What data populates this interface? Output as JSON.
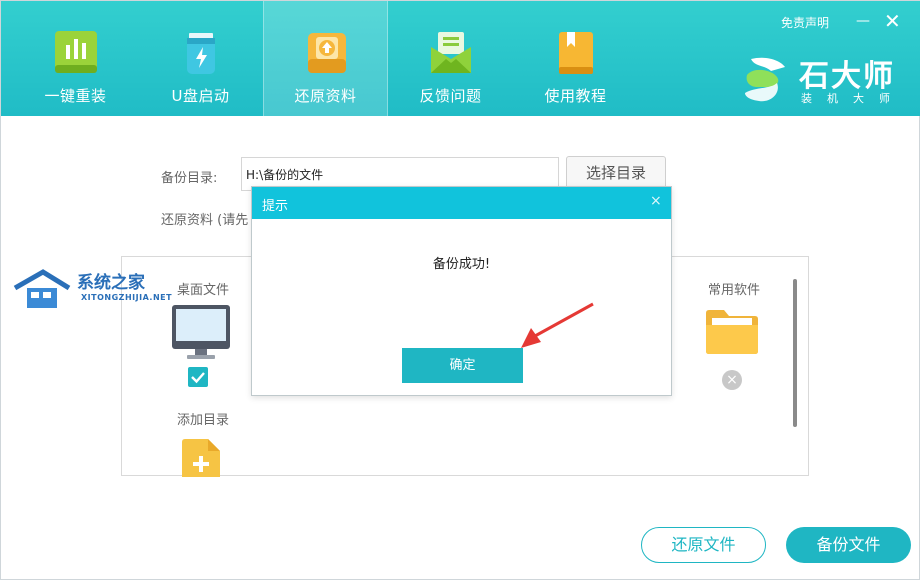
{
  "header": {
    "nav": [
      {
        "label": "一键重装",
        "icon": "reinstall-icon"
      },
      {
        "label": "U盘启动",
        "icon": "usb-drive-icon"
      },
      {
        "label": "还原资料",
        "icon": "restore-data-icon",
        "active": true
      },
      {
        "label": "反馈问题",
        "icon": "feedback-icon"
      },
      {
        "label": "使用教程",
        "icon": "tutorial-book-icon"
      }
    ],
    "disclaimer": "免责声明",
    "minimize": "—",
    "close": "✕",
    "brand_name": "石大师",
    "brand_sub": "装机大师"
  },
  "main": {
    "backup_dir_label": "备份目录:",
    "backup_dir_value": "H:\\备份的文件",
    "choose_dir_button": "选择目录",
    "restore_hint": "还原资料 (请先",
    "files": [
      {
        "label": "桌面文件",
        "icon": "desktop-monitor-icon",
        "state": "checked"
      },
      {
        "label": "常用软件",
        "icon": "folder-icon",
        "state": "excluded"
      },
      {
        "label": "添加目录",
        "icon": "add-file-icon"
      }
    ]
  },
  "watermark": {
    "title": "系统之家",
    "sub": "XITONGZHIJIA.NET"
  },
  "footer": {
    "restore_button": "还原文件",
    "backup_button": "备份文件"
  },
  "dialog": {
    "title": "提示",
    "close": "×",
    "message": "备份成功!",
    "ok_button": "确定"
  },
  "colors": {
    "accent": "#1fb6c3",
    "header": "#22bec6",
    "dialog_bar": "#11c3dc",
    "arrow": "#e53935"
  }
}
